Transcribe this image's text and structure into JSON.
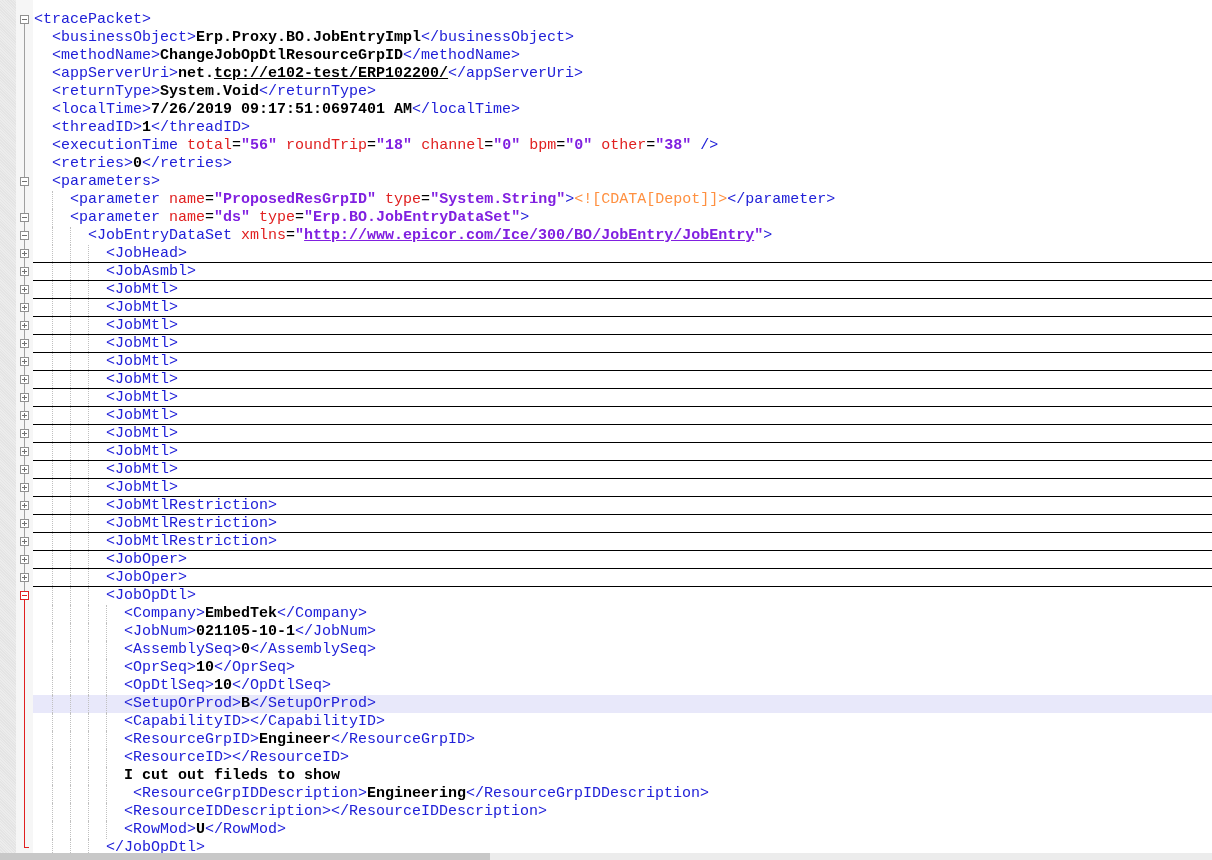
{
  "editor": {
    "lines": [
      {
        "expanded": true,
        "selected": false,
        "segments": [
          {
            "kind": "tag",
            "text": "<tracePacket>"
          }
        ],
        "children": [
          {
            "selected": false,
            "segments": [
              {
                "kind": "tag",
                "text": "<businessObject>"
              },
              {
                "kind": "text",
                "text": "Erp.Proxy.BO.JobEntryImpl"
              },
              {
                "kind": "tag",
                "text": "</businessObject>"
              }
            ]
          },
          {
            "selected": false,
            "segments": [
              {
                "kind": "tag",
                "text": "<methodName>"
              },
              {
                "kind": "text",
                "text": "ChangeJobOpDtlResourceGrpID"
              },
              {
                "kind": "tag",
                "text": "</methodName>"
              }
            ]
          },
          {
            "selected": false,
            "segments": [
              {
                "kind": "tag",
                "text": "<appServerUri>"
              },
              {
                "kind": "text",
                "text": "net."
              },
              {
                "kind": "text-link",
                "text": "tcp://e102-test/ERP102200/"
              },
              {
                "kind": "tag",
                "text": "</appServerUri>"
              }
            ]
          },
          {
            "selected": false,
            "segments": [
              {
                "kind": "tag",
                "text": "<returnType>"
              },
              {
                "kind": "text",
                "text": "System.Void"
              },
              {
                "kind": "tag",
                "text": "</returnType>"
              }
            ]
          },
          {
            "selected": false,
            "segments": [
              {
                "kind": "tag",
                "text": "<localTime>"
              },
              {
                "kind": "text",
                "text": "7/26/2019 09:17:51:0697401 AM"
              },
              {
                "kind": "tag",
                "text": "</localTime>"
              }
            ]
          },
          {
            "selected": false,
            "segments": [
              {
                "kind": "tag",
                "text": "<threadID>"
              },
              {
                "kind": "text",
                "text": "1"
              },
              {
                "kind": "tag",
                "text": "</threadID>"
              }
            ]
          },
          {
            "selected": false,
            "segments": [
              {
                "kind": "tag",
                "text": "<executionTime "
              },
              {
                "kind": "attr",
                "text": "total"
              },
              {
                "kind": "eq",
                "text": "="
              },
              {
                "kind": "value",
                "text": "\"56\" "
              },
              {
                "kind": "attr",
                "text": "roundTrip"
              },
              {
                "kind": "eq",
                "text": "="
              },
              {
                "kind": "value",
                "text": "\"18\" "
              },
              {
                "kind": "attr",
                "text": "channel"
              },
              {
                "kind": "eq",
                "text": "="
              },
              {
                "kind": "value",
                "text": "\"0\" "
              },
              {
                "kind": "attr",
                "text": "bpm"
              },
              {
                "kind": "eq",
                "text": "="
              },
              {
                "kind": "value",
                "text": "\"0\" "
              },
              {
                "kind": "attr",
                "text": "other"
              },
              {
                "kind": "eq",
                "text": "="
              },
              {
                "kind": "value",
                "text": "\"38\" "
              },
              {
                "kind": "tag",
                "text": "/>"
              }
            ]
          },
          {
            "selected": false,
            "segments": [
              {
                "kind": "tag",
                "text": "<retries>"
              },
              {
                "kind": "text",
                "text": "0"
              },
              {
                "kind": "tag",
                "text": "</retries>"
              }
            ]
          },
          {
            "expanded": true,
            "selected": false,
            "segments": [
              {
                "kind": "tag",
                "text": "<parameters>"
              }
            ],
            "children": [
              {
                "selected": false,
                "segments": [
                  {
                    "kind": "tag",
                    "text": "<parameter "
                  },
                  {
                    "kind": "attr",
                    "text": "name"
                  },
                  {
                    "kind": "eq",
                    "text": "="
                  },
                  {
                    "kind": "value",
                    "text": "\"ProposedResGrpID\" "
                  },
                  {
                    "kind": "attr",
                    "text": "type"
                  },
                  {
                    "kind": "eq",
                    "text": "="
                  },
                  {
                    "kind": "value",
                    "text": "\"System.String\""
                  },
                  {
                    "kind": "tag",
                    "text": ">"
                  },
                  {
                    "kind": "cdata",
                    "text": "<![CDATA[Depot]]>"
                  },
                  {
                    "kind": "tag",
                    "text": "</parameter>"
                  }
                ]
              },
              {
                "expanded": true,
                "selected": false,
                "segments": [
                  {
                    "kind": "tag",
                    "text": "<parameter "
                  },
                  {
                    "kind": "attr",
                    "text": "name"
                  },
                  {
                    "kind": "eq",
                    "text": "="
                  },
                  {
                    "kind": "value",
                    "text": "\"ds\" "
                  },
                  {
                    "kind": "attr",
                    "text": "type"
                  },
                  {
                    "kind": "eq",
                    "text": "="
                  },
                  {
                    "kind": "value",
                    "text": "\"Erp.BO.JobEntryDataSet\""
                  },
                  {
                    "kind": "tag",
                    "text": ">"
                  }
                ],
                "children": [
                  {
                    "expanded": true,
                    "selected": false,
                    "segments": [
                      {
                        "kind": "tag",
                        "text": "<JobEntryDataSet "
                      },
                      {
                        "kind": "attr",
                        "text": "xmlns"
                      },
                      {
                        "kind": "eq",
                        "text": "="
                      },
                      {
                        "kind": "value",
                        "text": "\""
                      },
                      {
                        "kind": "value-link",
                        "text": "http://www.epicor.com/Ice/300/BO/JobEntry/JobEntry"
                      },
                      {
                        "kind": "value",
                        "text": "\""
                      },
                      {
                        "kind": "tag",
                        "text": ">"
                      }
                    ],
                    "children": [
                      {
                        "expanded": false,
                        "selected": false,
                        "segments": [
                          {
                            "kind": "tag",
                            "text": "<JobHead>"
                          }
                        ]
                      },
                      {
                        "expanded": false,
                        "selected": false,
                        "segments": [
                          {
                            "kind": "tag",
                            "text": "<JobAsmbl>"
                          }
                        ]
                      },
                      {
                        "expanded": false,
                        "selected": false,
                        "segments": [
                          {
                            "kind": "tag",
                            "text": "<JobMtl>"
                          }
                        ]
                      },
                      {
                        "expanded": false,
                        "selected": false,
                        "segments": [
                          {
                            "kind": "tag",
                            "text": "<JobMtl>"
                          }
                        ]
                      },
                      {
                        "expanded": false,
                        "selected": false,
                        "segments": [
                          {
                            "kind": "tag",
                            "text": "<JobMtl>"
                          }
                        ]
                      },
                      {
                        "expanded": false,
                        "selected": false,
                        "segments": [
                          {
                            "kind": "tag",
                            "text": "<JobMtl>"
                          }
                        ]
                      },
                      {
                        "expanded": false,
                        "selected": false,
                        "segments": [
                          {
                            "kind": "tag",
                            "text": "<JobMtl>"
                          }
                        ]
                      },
                      {
                        "expanded": false,
                        "selected": false,
                        "segments": [
                          {
                            "kind": "tag",
                            "text": "<JobMtl>"
                          }
                        ]
                      },
                      {
                        "expanded": false,
                        "selected": false,
                        "segments": [
                          {
                            "kind": "tag",
                            "text": "<JobMtl>"
                          }
                        ]
                      },
                      {
                        "expanded": false,
                        "selected": false,
                        "segments": [
                          {
                            "kind": "tag",
                            "text": "<JobMtl>"
                          }
                        ]
                      },
                      {
                        "expanded": false,
                        "selected": false,
                        "segments": [
                          {
                            "kind": "tag",
                            "text": "<JobMtl>"
                          }
                        ]
                      },
                      {
                        "expanded": false,
                        "selected": false,
                        "segments": [
                          {
                            "kind": "tag",
                            "text": "<JobMtl>"
                          }
                        ]
                      },
                      {
                        "expanded": false,
                        "selected": false,
                        "segments": [
                          {
                            "kind": "tag",
                            "text": "<JobMtl>"
                          }
                        ]
                      },
                      {
                        "expanded": false,
                        "selected": false,
                        "segments": [
                          {
                            "kind": "tag",
                            "text": "<JobMtl>"
                          }
                        ]
                      },
                      {
                        "expanded": false,
                        "selected": false,
                        "segments": [
                          {
                            "kind": "tag",
                            "text": "<JobMtlRestriction>"
                          }
                        ]
                      },
                      {
                        "expanded": false,
                        "selected": false,
                        "segments": [
                          {
                            "kind": "tag",
                            "text": "<JobMtlRestriction>"
                          }
                        ]
                      },
                      {
                        "expanded": false,
                        "selected": false,
                        "segments": [
                          {
                            "kind": "tag",
                            "text": "<JobMtlRestriction>"
                          }
                        ]
                      },
                      {
                        "expanded": false,
                        "selected": false,
                        "segments": [
                          {
                            "kind": "tag",
                            "text": "<JobOper>"
                          }
                        ]
                      },
                      {
                        "expanded": false,
                        "selected": false,
                        "segments": [
                          {
                            "kind": "tag",
                            "text": "<JobOper>"
                          }
                        ]
                      },
                      {
                        "expanded": true,
                        "selected": false,
                        "segments": [
                          {
                            "kind": "tag",
                            "text": "<JobOpDtl>"
                          }
                        ],
                        "closing": [
                          {
                            "kind": "tag",
                            "text": "</JobOpDtl>"
                          }
                        ],
                        "children": [
                          {
                            "selected": false,
                            "segments": [
                              {
                                "kind": "tag",
                                "text": "<Company>"
                              },
                              {
                                "kind": "text",
                                "text": "EmbedTek"
                              },
                              {
                                "kind": "tag",
                                "text": "</Company>"
                              }
                            ]
                          },
                          {
                            "selected": false,
                            "segments": [
                              {
                                "kind": "tag",
                                "text": "<JobNum>"
                              },
                              {
                                "kind": "text",
                                "text": "021105-10-1"
                              },
                              {
                                "kind": "tag",
                                "text": "</JobNum>"
                              }
                            ]
                          },
                          {
                            "selected": false,
                            "segments": [
                              {
                                "kind": "tag",
                                "text": "<AssemblySeq>"
                              },
                              {
                                "kind": "text",
                                "text": "0"
                              },
                              {
                                "kind": "tag",
                                "text": "</AssemblySeq>"
                              }
                            ]
                          },
                          {
                            "selected": false,
                            "segments": [
                              {
                                "kind": "tag",
                                "text": "<OprSeq>"
                              },
                              {
                                "kind": "text",
                                "text": "10"
                              },
                              {
                                "kind": "tag",
                                "text": "</OprSeq>"
                              }
                            ]
                          },
                          {
                            "selected": false,
                            "segments": [
                              {
                                "kind": "tag",
                                "text": "<OpDtlSeq>"
                              },
                              {
                                "kind": "text",
                                "text": "10"
                              },
                              {
                                "kind": "tag",
                                "text": "</OpDtlSeq>"
                              }
                            ]
                          },
                          {
                            "selected": true,
                            "segments": [
                              {
                                "kind": "tag",
                                "text": "<SetupOrProd>"
                              },
                              {
                                "kind": "text",
                                "text": "B"
                              },
                              {
                                "kind": "tag",
                                "text": "</SetupOrProd>"
                              }
                            ]
                          },
                          {
                            "selected": false,
                            "segments": [
                              {
                                "kind": "tag",
                                "text": "<CapabilityID></CapabilityID>"
                              }
                            ]
                          },
                          {
                            "selected": false,
                            "segments": [
                              {
                                "kind": "tag",
                                "text": "<ResourceGrpID>"
                              },
                              {
                                "kind": "text",
                                "text": "Engineer"
                              },
                              {
                                "kind": "tag",
                                "text": "</ResourceGrpID>"
                              }
                            ]
                          },
                          {
                            "selected": false,
                            "segments": [
                              {
                                "kind": "tag",
                                "text": "<ResourceID></ResourceID>"
                              }
                            ]
                          },
                          {
                            "selected": false,
                            "segments": [
                              {
                                "kind": "text",
                                "text": "I cut out fileds to show"
                              }
                            ]
                          },
                          {
                            "selected": false,
                            "segments": [
                              {
                                "kind": "tag",
                                "text": " <ResourceGrpIDDescription>"
                              },
                              {
                                "kind": "text",
                                "text": "Engineering"
                              },
                              {
                                "kind": "tag",
                                "text": "</ResourceGrpIDDescription>"
                              }
                            ]
                          },
                          {
                            "selected": false,
                            "segments": [
                              {
                                "kind": "tag",
                                "text": "<ResourceIDDescription></ResourceIDDescription>"
                              }
                            ]
                          },
                          {
                            "selected": false,
                            "segments": [
                              {
                                "kind": "tag",
                                "text": "<RowMod>"
                              },
                              {
                                "kind": "text",
                                "text": "U"
                              },
                              {
                                "kind": "tag",
                                "text": "</RowMod>"
                              }
                            ]
                          }
                        ]
                      }
                    ]
                  }
                ]
              }
            ]
          }
        ]
      }
    ]
  }
}
